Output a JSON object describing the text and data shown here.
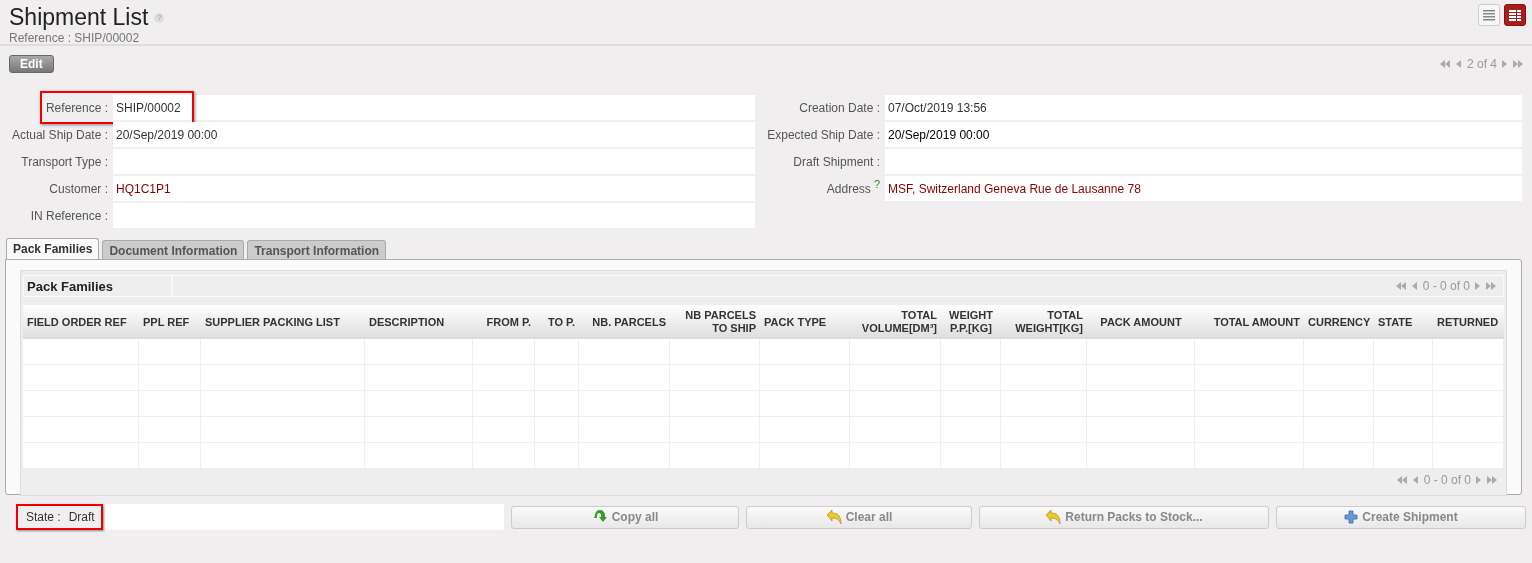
{
  "header": {
    "title": "Shipment List",
    "subtitle": "Reference : SHIP/00002",
    "help": "?",
    "views": [
      {
        "kind": "list",
        "selected": false
      },
      {
        "kind": "form",
        "selected": true
      }
    ]
  },
  "toolbar": {
    "edit": "Edit",
    "pager": "2 of 4"
  },
  "form": {
    "left": [
      {
        "label": "Reference :",
        "value": "SHIP/00002",
        "highlighted": true
      },
      {
        "label": "Actual Ship Date :",
        "value": "20/Sep/2019 00:00",
        "highlighted": false
      },
      {
        "label": "Transport Type :",
        "highlighted": false
      },
      {
        "label": "Customer :",
        "value": "HQ1C1P1",
        "link": true,
        "highlighted": false
      },
      {
        "label": "IN Reference :",
        "highlighted": false
      }
    ],
    "right": [
      {
        "label": "Creation Date :",
        "value": "07/Oct/2019 13:56",
        "highlighted": false
      },
      {
        "label": "Expected Ship Date :",
        "value": "20/Sep/2019 00:00",
        "strong": true,
        "highlighted": false
      },
      {
        "label": "Draft Shipment :",
        "highlighted": false
      },
      {
        "label": "Address",
        "help": "?",
        "value": "MSF, Switzerland Geneva Rue de Lausanne 78",
        "link": true,
        "highlighted": false
      }
    ]
  },
  "tabs": [
    {
      "label": "Pack Families",
      "selected": true
    },
    {
      "label": "Document Information",
      "selected": false
    },
    {
      "label": "Transport Information",
      "selected": false
    }
  ],
  "table": {
    "title": "Pack Families",
    "pager_top": "0 - 0 of 0",
    "pager_bottom": "0 - 0 of 0",
    "columns": [
      "FIELD ORDER REF",
      "PPL REF",
      "SUPPLIER PACKING LIST",
      "DESCRIPTION",
      "FROM P.",
      "TO P.",
      "NB. PARCELS",
      "NB PARCELS TO SHIP",
      "PACK TYPE",
      "TOTAL VOLUME[DM³]",
      "WEIGHT P.P.[KG]",
      "TOTAL WEIGHT[KG]",
      "PACK AMOUNT",
      "TOTAL AMOUNT",
      "CURRENCY",
      "STATE",
      "RETURNED"
    ]
  },
  "footer": {
    "state_label": "State :",
    "state_value": "Draft",
    "state_highlighted": true,
    "buttons": [
      {
        "label": "Copy all",
        "kind": "copy"
      },
      {
        "label": "Clear all",
        "kind": "undo"
      },
      {
        "label": "Return Packs to Stock...",
        "kind": "undo"
      },
      {
        "label": "Create Shipment",
        "kind": "add"
      }
    ]
  }
}
